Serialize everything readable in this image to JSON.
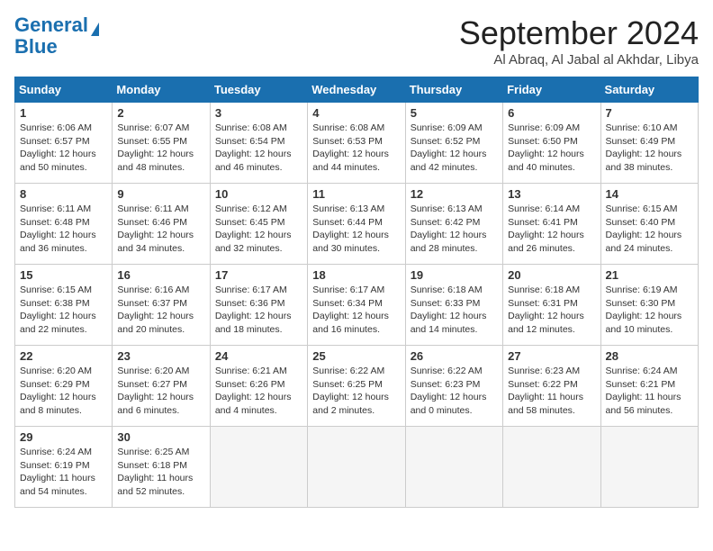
{
  "header": {
    "logo_line1": "General",
    "logo_line2": "Blue",
    "month": "September 2024",
    "location": "Al Abraq, Al Jabal al Akhdar, Libya"
  },
  "weekdays": [
    "Sunday",
    "Monday",
    "Tuesday",
    "Wednesday",
    "Thursday",
    "Friday",
    "Saturday"
  ],
  "weeks": [
    [
      {
        "day": "1",
        "lines": [
          "Sunrise: 6:06 AM",
          "Sunset: 6:57 PM",
          "Daylight: 12 hours",
          "and 50 minutes."
        ]
      },
      {
        "day": "2",
        "lines": [
          "Sunrise: 6:07 AM",
          "Sunset: 6:55 PM",
          "Daylight: 12 hours",
          "and 48 minutes."
        ]
      },
      {
        "day": "3",
        "lines": [
          "Sunrise: 6:08 AM",
          "Sunset: 6:54 PM",
          "Daylight: 12 hours",
          "and 46 minutes."
        ]
      },
      {
        "day": "4",
        "lines": [
          "Sunrise: 6:08 AM",
          "Sunset: 6:53 PM",
          "Daylight: 12 hours",
          "and 44 minutes."
        ]
      },
      {
        "day": "5",
        "lines": [
          "Sunrise: 6:09 AM",
          "Sunset: 6:52 PM",
          "Daylight: 12 hours",
          "and 42 minutes."
        ]
      },
      {
        "day": "6",
        "lines": [
          "Sunrise: 6:09 AM",
          "Sunset: 6:50 PM",
          "Daylight: 12 hours",
          "and 40 minutes."
        ]
      },
      {
        "day": "7",
        "lines": [
          "Sunrise: 6:10 AM",
          "Sunset: 6:49 PM",
          "Daylight: 12 hours",
          "and 38 minutes."
        ]
      }
    ],
    [
      {
        "day": "8",
        "lines": [
          "Sunrise: 6:11 AM",
          "Sunset: 6:48 PM",
          "Daylight: 12 hours",
          "and 36 minutes."
        ]
      },
      {
        "day": "9",
        "lines": [
          "Sunrise: 6:11 AM",
          "Sunset: 6:46 PM",
          "Daylight: 12 hours",
          "and 34 minutes."
        ]
      },
      {
        "day": "10",
        "lines": [
          "Sunrise: 6:12 AM",
          "Sunset: 6:45 PM",
          "Daylight: 12 hours",
          "and 32 minutes."
        ]
      },
      {
        "day": "11",
        "lines": [
          "Sunrise: 6:13 AM",
          "Sunset: 6:44 PM",
          "Daylight: 12 hours",
          "and 30 minutes."
        ]
      },
      {
        "day": "12",
        "lines": [
          "Sunrise: 6:13 AM",
          "Sunset: 6:42 PM",
          "Daylight: 12 hours",
          "and 28 minutes."
        ]
      },
      {
        "day": "13",
        "lines": [
          "Sunrise: 6:14 AM",
          "Sunset: 6:41 PM",
          "Daylight: 12 hours",
          "and 26 minutes."
        ]
      },
      {
        "day": "14",
        "lines": [
          "Sunrise: 6:15 AM",
          "Sunset: 6:40 PM",
          "Daylight: 12 hours",
          "and 24 minutes."
        ]
      }
    ],
    [
      {
        "day": "15",
        "lines": [
          "Sunrise: 6:15 AM",
          "Sunset: 6:38 PM",
          "Daylight: 12 hours",
          "and 22 minutes."
        ]
      },
      {
        "day": "16",
        "lines": [
          "Sunrise: 6:16 AM",
          "Sunset: 6:37 PM",
          "Daylight: 12 hours",
          "and 20 minutes."
        ]
      },
      {
        "day": "17",
        "lines": [
          "Sunrise: 6:17 AM",
          "Sunset: 6:36 PM",
          "Daylight: 12 hours",
          "and 18 minutes."
        ]
      },
      {
        "day": "18",
        "lines": [
          "Sunrise: 6:17 AM",
          "Sunset: 6:34 PM",
          "Daylight: 12 hours",
          "and 16 minutes."
        ]
      },
      {
        "day": "19",
        "lines": [
          "Sunrise: 6:18 AM",
          "Sunset: 6:33 PM",
          "Daylight: 12 hours",
          "and 14 minutes."
        ]
      },
      {
        "day": "20",
        "lines": [
          "Sunrise: 6:18 AM",
          "Sunset: 6:31 PM",
          "Daylight: 12 hours",
          "and 12 minutes."
        ]
      },
      {
        "day": "21",
        "lines": [
          "Sunrise: 6:19 AM",
          "Sunset: 6:30 PM",
          "Daylight: 12 hours",
          "and 10 minutes."
        ]
      }
    ],
    [
      {
        "day": "22",
        "lines": [
          "Sunrise: 6:20 AM",
          "Sunset: 6:29 PM",
          "Daylight: 12 hours",
          "and 8 minutes."
        ]
      },
      {
        "day": "23",
        "lines": [
          "Sunrise: 6:20 AM",
          "Sunset: 6:27 PM",
          "Daylight: 12 hours",
          "and 6 minutes."
        ]
      },
      {
        "day": "24",
        "lines": [
          "Sunrise: 6:21 AM",
          "Sunset: 6:26 PM",
          "Daylight: 12 hours",
          "and 4 minutes."
        ]
      },
      {
        "day": "25",
        "lines": [
          "Sunrise: 6:22 AM",
          "Sunset: 6:25 PM",
          "Daylight: 12 hours",
          "and 2 minutes."
        ]
      },
      {
        "day": "26",
        "lines": [
          "Sunrise: 6:22 AM",
          "Sunset: 6:23 PM",
          "Daylight: 12 hours",
          "and 0 minutes."
        ]
      },
      {
        "day": "27",
        "lines": [
          "Sunrise: 6:23 AM",
          "Sunset: 6:22 PM",
          "Daylight: 11 hours",
          "and 58 minutes."
        ]
      },
      {
        "day": "28",
        "lines": [
          "Sunrise: 6:24 AM",
          "Sunset: 6:21 PM",
          "Daylight: 11 hours",
          "and 56 minutes."
        ]
      }
    ],
    [
      {
        "day": "29",
        "lines": [
          "Sunrise: 6:24 AM",
          "Sunset: 6:19 PM",
          "Daylight: 11 hours",
          "and 54 minutes."
        ]
      },
      {
        "day": "30",
        "lines": [
          "Sunrise: 6:25 AM",
          "Sunset: 6:18 PM",
          "Daylight: 11 hours",
          "and 52 minutes."
        ]
      },
      {
        "day": "",
        "lines": []
      },
      {
        "day": "",
        "lines": []
      },
      {
        "day": "",
        "lines": []
      },
      {
        "day": "",
        "lines": []
      },
      {
        "day": "",
        "lines": []
      }
    ]
  ]
}
